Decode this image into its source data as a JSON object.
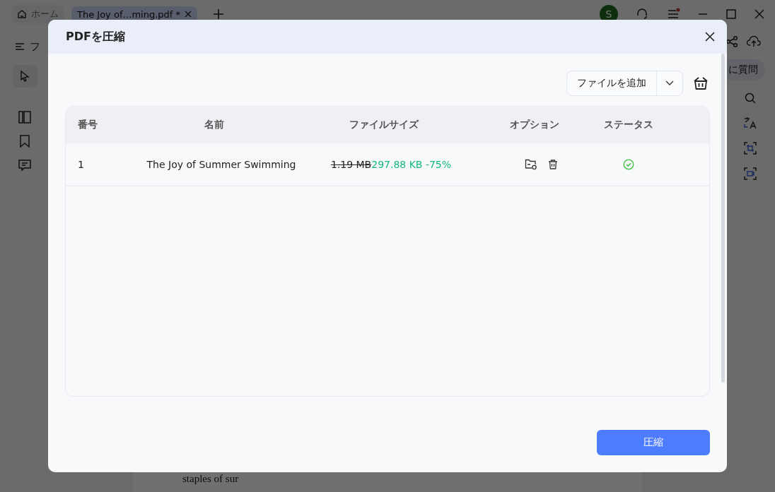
{
  "app": {
    "tabs": [
      {
        "label": "ホーム",
        "kind": "home",
        "selected": false
      },
      {
        "label": "The Joy of…ming.pdf *",
        "kind": "doc",
        "selected": true
      }
    ],
    "avatar_initial": "S",
    "menu_label": "フ",
    "ask_button": "に質問",
    "document_text": "staples of sur"
  },
  "dialog": {
    "title": "PDFを圧縮",
    "add_button": "ファイルを追加",
    "table": {
      "columns": [
        "番号",
        "名前",
        "ファイルサイズ",
        "オプション",
        "ステータス"
      ],
      "rows": [
        {
          "number": "1",
          "name": "The Joy of Summer Swimming",
          "original_size": "1.19 MB",
          "compressed_size": "297.88 KB -75%",
          "completed": true
        }
      ]
    },
    "compress_button": "圧縮"
  }
}
